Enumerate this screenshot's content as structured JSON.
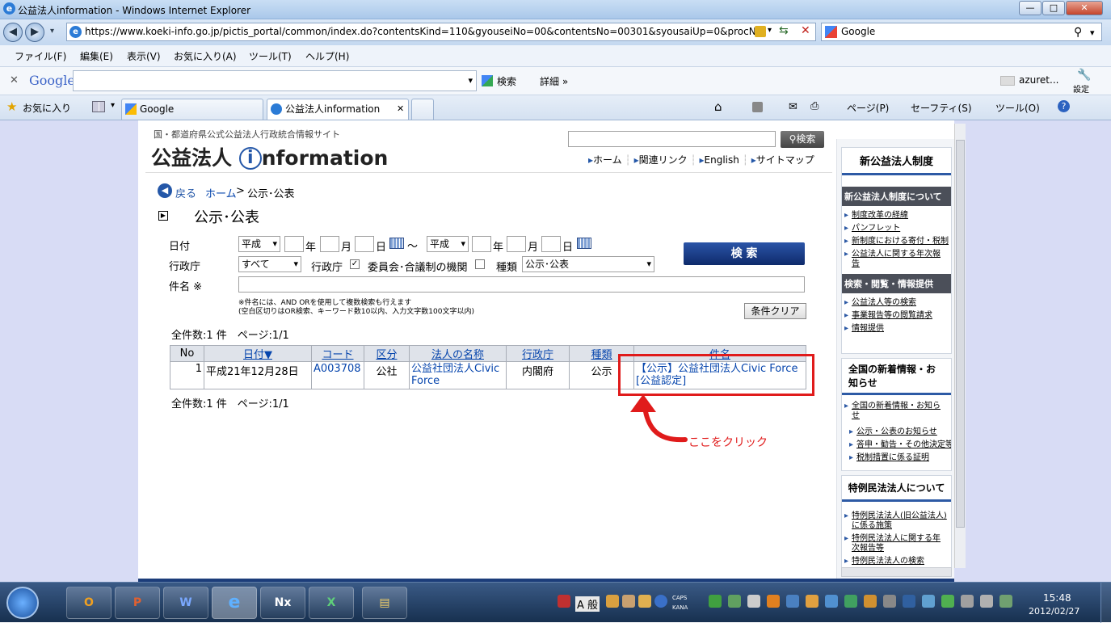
{
  "window": {
    "title": "公益法人information - Windows Internet Explorer",
    "min": "—",
    "max": "□",
    "close": "✕"
  },
  "address": {
    "url": "https://www.koeki-info.go.jp/pictis_portal/common/index.do?contentsKind=110&gyouseiNo=00&contentsNo=00301&syousaiUp=0&procN",
    "search_engine": "Google"
  },
  "menu": [
    "ファイル(F)",
    "編集(E)",
    "表示(V)",
    "お気に入り(A)",
    "ツール(T)",
    "ヘルプ(H)"
  ],
  "gbar": {
    "logo": "Google",
    "search_label": "検索",
    "details_label": "詳細 »",
    "user": "azuret...",
    "settings_label": "設定"
  },
  "favbar": {
    "favorites": "お気に入り",
    "tabs": [
      "Google",
      "公益法人information"
    ],
    "tools": [
      "ページ(P)",
      "セーフティ(S)",
      "ツール(O)"
    ]
  },
  "site": {
    "tagline": "国・都道府県公式公益法人行政統合情報サイト",
    "logo_a": "公益法人",
    "logo_i": "i",
    "logo_b": "nformation",
    "search_btn": "検索",
    "nav": [
      "ホーム",
      "関連リンク",
      "English",
      "サイトマップ"
    ],
    "back": "戻る",
    "breadcrumb_home": "ホーム",
    "breadcrumb_sep": ">",
    "breadcrumb_current": "公示･公表",
    "page_title": "公示･公表"
  },
  "form": {
    "date_label": "日付",
    "era1": "平成",
    "era2": "平成",
    "year": "年",
    "month": "月",
    "day": "日",
    "tilde": "～",
    "agency_label": "行政庁",
    "agency_value": "すべて",
    "cb1_label": "行政庁",
    "cb2_label": "委員会･合議制の機関",
    "type_label": "種類",
    "type_value": "公示･公表",
    "name_label": "件名 ※",
    "note1": "※件名には、AND ORを使用して複数検索も行えます",
    "note2": "(空白区切りはOR検索、キーワード数10以内、入力文字数100文字以内)",
    "search_btn": "検 索",
    "clear_btn": "条件クリア"
  },
  "results": {
    "summary": "全件数:1 件　ページ:1/1",
    "headers": [
      "No",
      "日付▼",
      "コード",
      "区分",
      "法人の名称",
      "行政庁",
      "種類",
      "件名"
    ],
    "rows": [
      {
        "no": "1",
        "date": "平成21年12月28日",
        "code": "A003708",
        "kubun": "公社",
        "name": "公益社団法人Civic Force",
        "agency": "内閣府",
        "type": "公示",
        "title": "【公示】公益社団法人Civic Force[公益認定]"
      }
    ],
    "summary_bottom": "全件数:1 件　ページ:1/1"
  },
  "annotation": {
    "text": "ここをクリック",
    "color": "#e01b1b"
  },
  "sidebar": {
    "box1_head": "新公益法人制度",
    "box1_sub1": "新公益法人制度について",
    "box1_links": [
      "制度改革の経緯",
      "パンフレット",
      "新制度における寄付・税制",
      "公益法人に関する年次報告"
    ],
    "box1_sub2": "検索・閲覧・情報提供",
    "box1_links2": [
      "公益法人等の検索",
      "事業報告等の閲覧請求",
      "情報提供"
    ],
    "box2_head": "全国の新着情報・お知らせ",
    "box2_links": [
      "全国の新着情報・お知らせ"
    ],
    "box2_links2": [
      "公示・公表のお知らせ",
      "答申・勧告・その他決定等",
      "税制措置に係る証明"
    ],
    "box3_head": "特例民法法人について",
    "box3_links": [
      "特例民法法人(旧公益法人)に係る施策",
      "特例民法法人に関する年次報告等",
      "特例民法法人の検索"
    ]
  },
  "taskbar": {
    "apps": [
      "O",
      "P",
      "W",
      "e",
      "Nx",
      "X",
      "▤"
    ],
    "ime": "A 般",
    "caps": "CAPS",
    "kana": "KANA",
    "time": "15:48",
    "date": "2012/02/27"
  }
}
